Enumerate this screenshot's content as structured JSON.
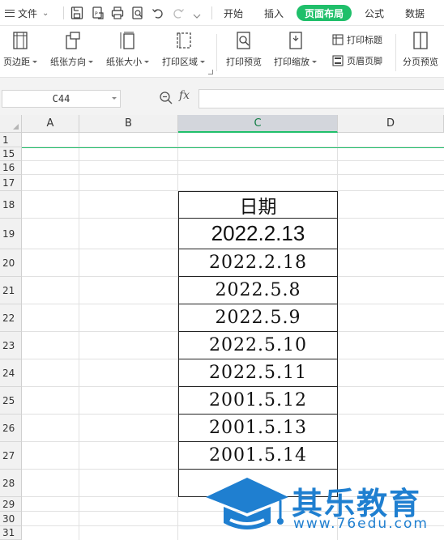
{
  "menubar": {
    "file_label": "文件",
    "tabs": [
      {
        "label": "开始",
        "active": false
      },
      {
        "label": "插入",
        "active": false
      },
      {
        "label": "页面布局",
        "active": true
      },
      {
        "label": "公式",
        "active": false
      },
      {
        "label": "数据",
        "active": false
      }
    ],
    "active_color": "#1fbf6a"
  },
  "ribbon": {
    "margins": "页边距",
    "orientation": "纸张方向",
    "size": "纸张大小",
    "print_area": "打印区域",
    "print_preview": "打印预览",
    "print_scale": "打印缩放",
    "print_titles": "打印标题",
    "header_footer": "页眉页脚",
    "page_break_preview": "分页预览"
  },
  "formula_bar": {
    "name_box": "C44",
    "fx_label": "fx",
    "content": ""
  },
  "sheet": {
    "columns": [
      "A",
      "B",
      "C",
      "D"
    ],
    "selected_column": "C",
    "rows": [
      "1",
      "15",
      "16",
      "17",
      "18",
      "19",
      "20",
      "21",
      "22",
      "23",
      "24",
      "25",
      "26",
      "27",
      "28",
      "29",
      "30",
      "31"
    ],
    "date_cells": [
      "日期",
      "2022.2.13",
      "2022.2.18",
      "2022.5.8",
      "2022.5.9",
      "2022.5.10",
      "2022.5.11",
      "2001.5.12",
      "2001.5.13",
      "2001.5.14",
      ""
    ]
  },
  "watermark": {
    "brand": "其乐教育",
    "url": "www.76edu.com",
    "color": "#1f7fd0"
  }
}
